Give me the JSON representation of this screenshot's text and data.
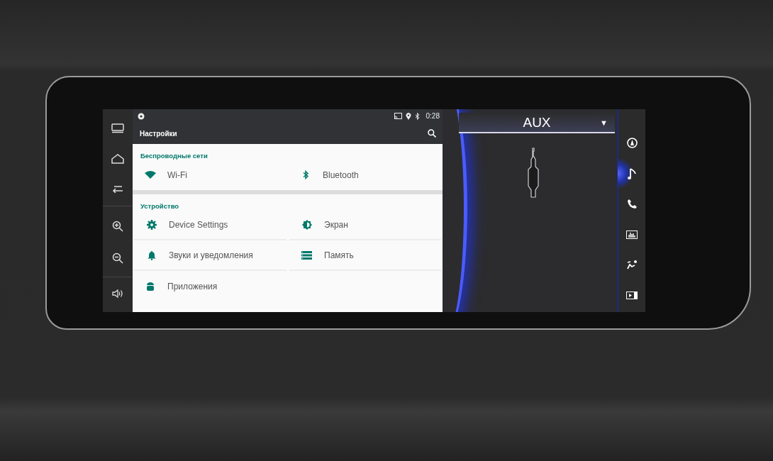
{
  "status_bar": {
    "time": "0:28"
  },
  "toolbar": {
    "title": "Настройки"
  },
  "sections": [
    {
      "title": "Беспроводные сети",
      "items": [
        {
          "label": "Wi-Fi"
        },
        {
          "label": "Bluetooth"
        }
      ]
    },
    {
      "title": "Устройство",
      "items": [
        {
          "label": "Device Settings"
        },
        {
          "label": "Экран"
        },
        {
          "label": "Звуки и уведомления"
        },
        {
          "label": "Память"
        },
        {
          "label": "Приложения"
        }
      ]
    }
  ],
  "source": {
    "title": "AUX",
    "dropdown": "▼"
  },
  "media_menu": [
    {
      "selected": false
    },
    {
      "selected": true
    },
    {
      "selected": false
    },
    {
      "selected": false
    },
    {
      "selected": false
    },
    {
      "selected": false
    }
  ]
}
